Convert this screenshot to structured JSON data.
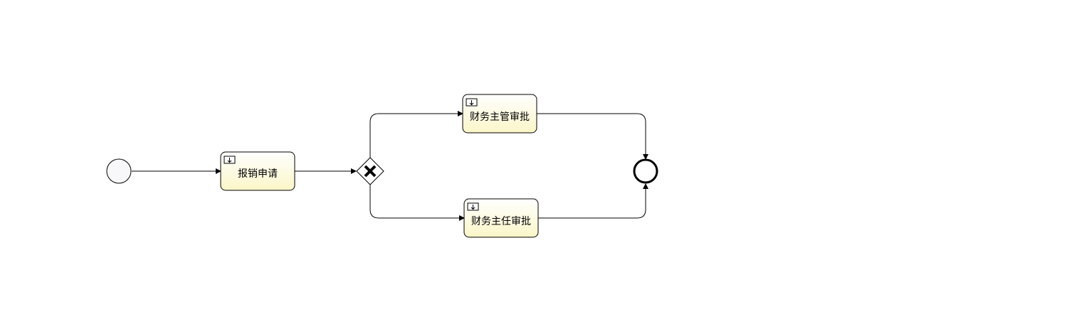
{
  "diagram": {
    "colors": {
      "task_fill_top": "#ffffff",
      "task_fill_bottom": "#fbf6c8",
      "stroke": "#000000",
      "start_fill": "#f8f8fb"
    },
    "nodes": {
      "start": {
        "kind": "start-event"
      },
      "apply": {
        "kind": "user-task",
        "label": "报销申请",
        "icon": "user-task-icon"
      },
      "gateway": {
        "kind": "exclusive-gateway",
        "icon": "x-icon"
      },
      "manager": {
        "kind": "user-task",
        "label": "财务主管审批",
        "icon": "user-task-icon"
      },
      "director": {
        "kind": "user-task",
        "label": "财务主任审批",
        "icon": "user-task-icon"
      },
      "end": {
        "kind": "end-event"
      }
    },
    "flows": [
      {
        "from": "start",
        "to": "apply"
      },
      {
        "from": "apply",
        "to": "gateway"
      },
      {
        "from": "gateway",
        "to": "manager"
      },
      {
        "from": "gateway",
        "to": "director"
      },
      {
        "from": "manager",
        "to": "end"
      },
      {
        "from": "director",
        "to": "end"
      }
    ]
  }
}
